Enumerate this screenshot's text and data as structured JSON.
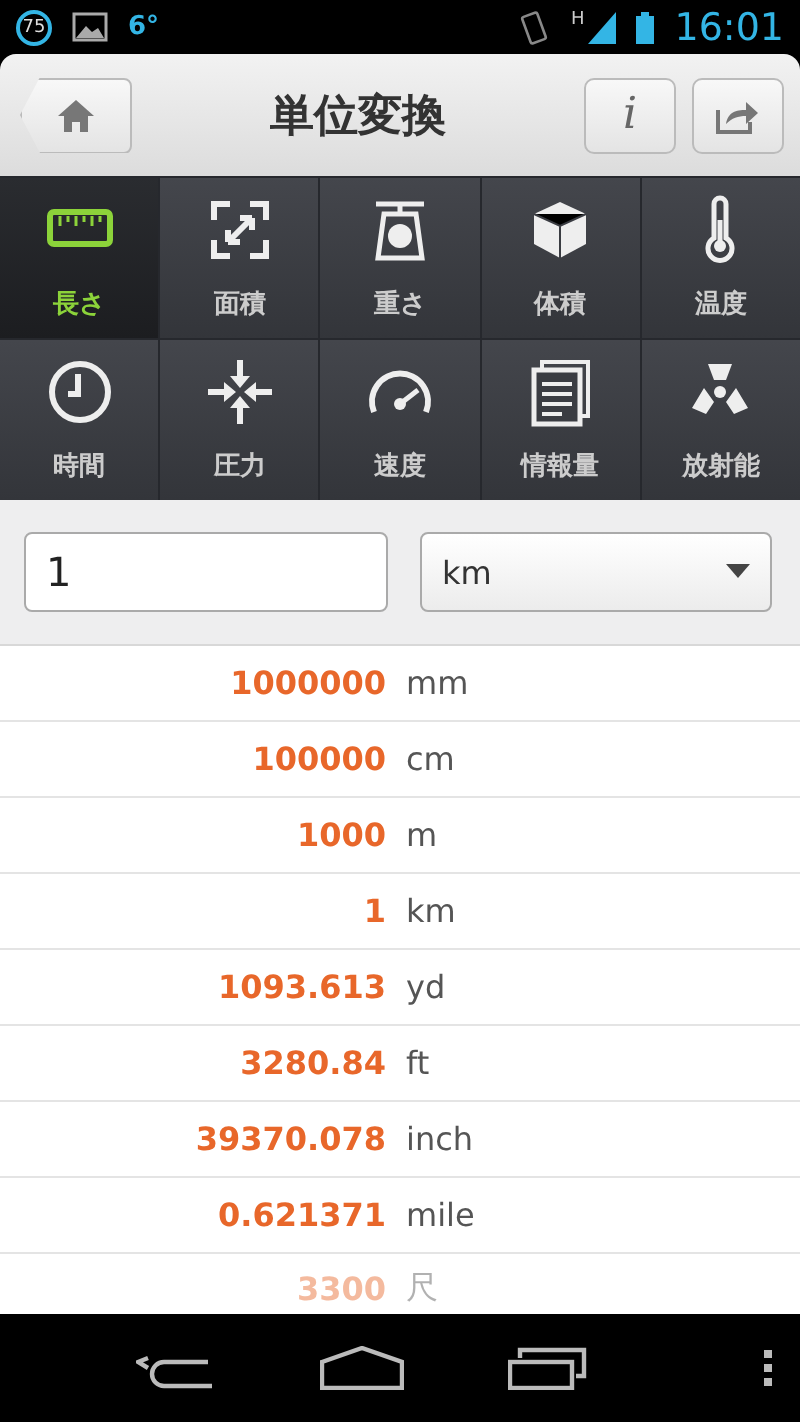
{
  "status_bar": {
    "badge": "75",
    "temperature": "6°",
    "network": "H",
    "time": "16:01"
  },
  "header": {
    "title": "単位変換",
    "info_label": "i"
  },
  "categories": [
    {
      "label": "長さ",
      "kind": "ruler",
      "selected": true
    },
    {
      "label": "面積",
      "kind": "expand",
      "selected": false
    },
    {
      "label": "重さ",
      "kind": "scale",
      "selected": false
    },
    {
      "label": "体積",
      "kind": "cube",
      "selected": false
    },
    {
      "label": "温度",
      "kind": "thermometer",
      "selected": false
    },
    {
      "label": "時間",
      "kind": "clock",
      "selected": false
    },
    {
      "label": "圧力",
      "kind": "compress",
      "selected": false
    },
    {
      "label": "速度",
      "kind": "gauge",
      "selected": false
    },
    {
      "label": "情報量",
      "kind": "document",
      "selected": false
    },
    {
      "label": "放射能",
      "kind": "radiation",
      "selected": false
    }
  ],
  "input": {
    "value": "1",
    "unit": "km"
  },
  "results": [
    {
      "value": "1000000",
      "unit": "mm"
    },
    {
      "value": "100000",
      "unit": "cm"
    },
    {
      "value": "1000",
      "unit": "m"
    },
    {
      "value": "1",
      "unit": "km"
    },
    {
      "value": "1093.613",
      "unit": "yd"
    },
    {
      "value": "3280.84",
      "unit": "ft"
    },
    {
      "value": "39370.078",
      "unit": "inch"
    },
    {
      "value": "0.621371",
      "unit": "mile"
    },
    {
      "value": "3300",
      "unit": "尺"
    }
  ]
}
